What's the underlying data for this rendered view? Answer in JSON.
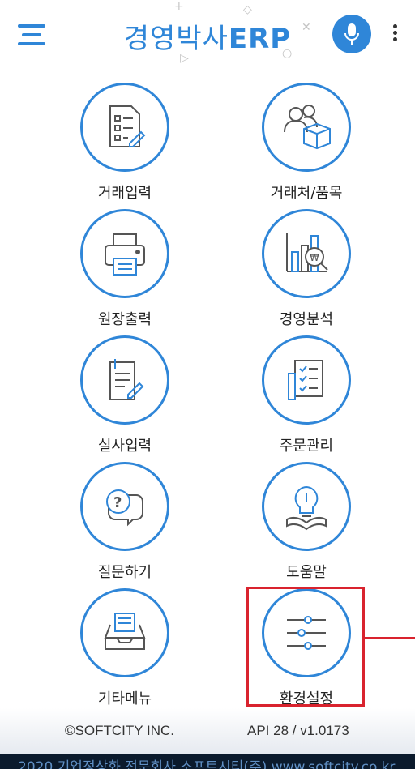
{
  "header": {
    "title_ko": "경영박사",
    "title_en": "ERP",
    "menu_icon": "hamburger-icon",
    "mic_icon": "microphone-icon",
    "more_icon": "more-vertical-icon",
    "accent_color": "#2f86d8"
  },
  "menu": {
    "items": [
      {
        "label": "거래입력",
        "icon": "document-edit-icon"
      },
      {
        "label": "거래처/품목",
        "icon": "people-box-icon"
      },
      {
        "label": "원장출력",
        "icon": "printer-icon"
      },
      {
        "label": "경영분석",
        "icon": "chart-magnifier-icon"
      },
      {
        "label": "실사입력",
        "icon": "clipboard-pen-icon"
      },
      {
        "label": "주문관리",
        "icon": "checklist-icon"
      },
      {
        "label": "질문하기",
        "icon": "question-chat-icon"
      },
      {
        "label": "도움말",
        "icon": "lightbulb-book-icon"
      },
      {
        "label": "기타메뉴",
        "icon": "inbox-tray-icon"
      },
      {
        "label": "환경설정",
        "icon": "sliders-icon"
      }
    ],
    "highlight_color": "#d9232e"
  },
  "footer": {
    "copyright": "©SOFTCITY INC.",
    "version": "API 28 / v1.0173"
  },
  "bottom_bar": {
    "text": "2020 기업정상화 전문회사 소프트시티(주) www.softcity.co.kr"
  }
}
